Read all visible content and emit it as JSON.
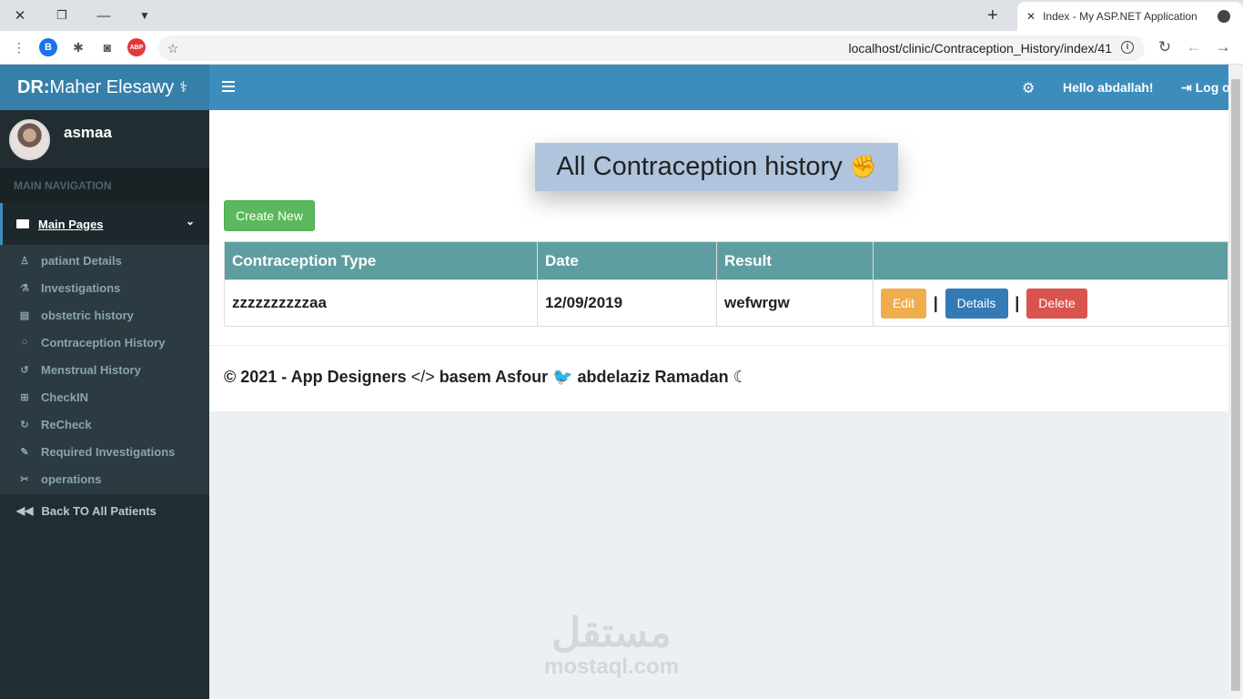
{
  "browser": {
    "tab_title": "Index - My ASP.NET Application",
    "url": "localhost/clinic/Contraception_History/index/41",
    "extensions": [
      "B",
      "ABP"
    ]
  },
  "header": {
    "brand_bold": "DR:",
    "brand_name": "Maher Elesawy",
    "greeting": "Hello abdallah!",
    "logoff": "Log o"
  },
  "sidebar": {
    "user_name": "asmaa",
    "nav_header": "MAIN NAVIGATION",
    "main_group": "Main Pages",
    "items": [
      {
        "label": "patiant Details",
        "icon": "user-md-icon"
      },
      {
        "label": "Investigations",
        "icon": "flask-icon"
      },
      {
        "label": "obstetric history",
        "icon": "clipboard-icon"
      },
      {
        "label": "Contraception History",
        "icon": "comment-icon"
      },
      {
        "label": "Menstrual History",
        "icon": "history-icon"
      },
      {
        "label": "CheckIN",
        "icon": "medkit-icon"
      },
      {
        "label": "ReCheck",
        "icon": "refresh-icon"
      },
      {
        "label": "Required Investigations",
        "icon": "eyedropper-icon"
      },
      {
        "label": "operations",
        "icon": "scissors-icon"
      }
    ],
    "back": "Back TO All Patients"
  },
  "main": {
    "title": "All Contraception history",
    "create_button": "Create New",
    "columns": [
      "Contraception Type",
      "Date",
      "Result",
      ""
    ],
    "rows": [
      {
        "type": "zzzzzzzzzzaa",
        "date": "12/09/2019",
        "result": "wefwrgw"
      }
    ],
    "actions": {
      "edit": "Edit",
      "details": "Details",
      "delete": "Delete",
      "separator": "|"
    },
    "footer": {
      "prefix": "© 2021 - App Designers",
      "name1": "basem Asfour",
      "name2": "abdelaziz Ramadan"
    }
  },
  "watermark": {
    "logo": "مستقل",
    "site": "mostaql.com"
  },
  "colors": {
    "brand": "#367fa9",
    "navbar": "#3c8dbc",
    "sidebar": "#222d32",
    "table_header": "#5f9ea0",
    "create": "#5cb85c",
    "edit": "#f0ad4e",
    "details": "#337ab7",
    "delete": "#d9534f"
  }
}
